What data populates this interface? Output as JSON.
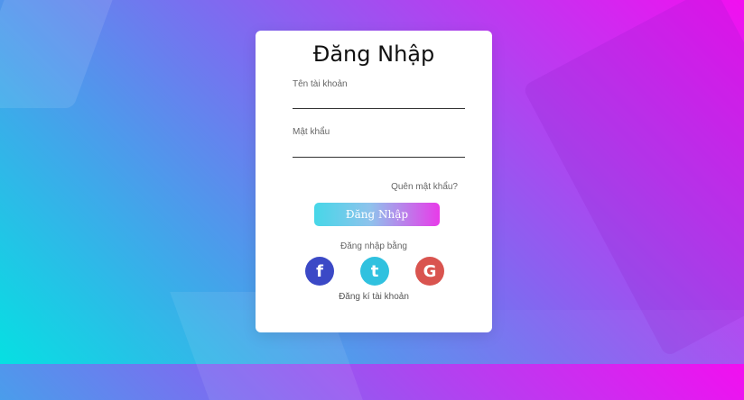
{
  "theme": {
    "bg_gradient": [
      "#f20ff0",
      "#7a6ef0",
      "#06e0e2"
    ],
    "button_gradient": [
      "#46d7e8",
      "#e83be9"
    ],
    "facebook_color": "#3b49c6",
    "twitter_color": "#30c1df",
    "google_color": "#d9544f"
  },
  "login": {
    "title": "Đăng Nhập",
    "username_label": "Tên tài khoản",
    "username_value": "",
    "password_label": "Mật khẩu",
    "password_value": "",
    "forgot_password": "Quên mật khẩu?",
    "submit_label": "Đăng Nhập",
    "login_with": "Đăng nhập bằng",
    "register": "Đăng kí tài khoản"
  },
  "socials": [
    {
      "icon": "facebook-icon",
      "glyph": "f"
    },
    {
      "icon": "twitter-icon",
      "glyph": "t"
    },
    {
      "icon": "google-icon",
      "glyph": "G"
    }
  ]
}
